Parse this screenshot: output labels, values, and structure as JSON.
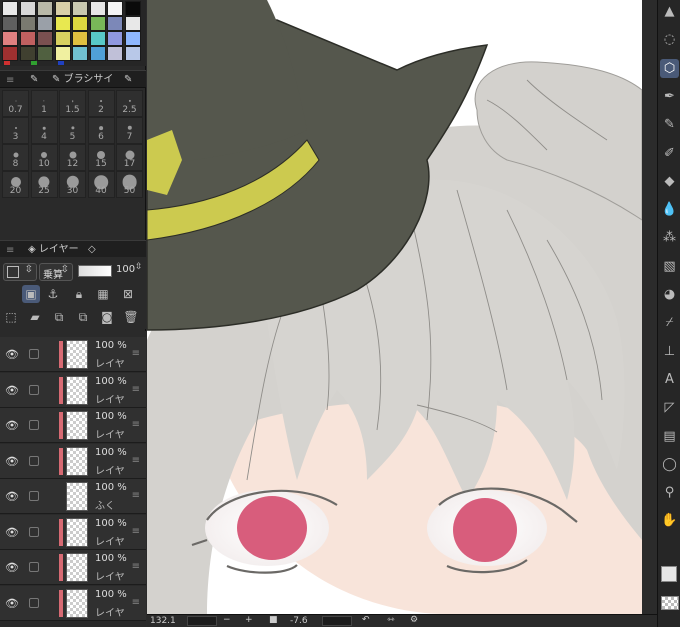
{
  "palette": {
    "rows": [
      [
        "#e8e8e8",
        "#d8d8d8",
        "#b8b8a8",
        "#d8cfa8",
        "#c8c8b0",
        "#e6e6e6",
        "#f4f4f4",
        "#0a0a0a"
      ],
      [
        "#5f5f5f",
        "#7a7a70",
        "#9aa0a8",
        "#e8e850",
        "#dcd840",
        "#78b858",
        "#7c88b8",
        "#e8e8e8"
      ],
      [
        "#e08080",
        "#c06060",
        "#7a5050",
        "#d8d060",
        "#e0c040",
        "#58c8c8",
        "#9098e0",
        "#8fb8ff"
      ],
      [
        "#a03030",
        "#404030",
        "#506040",
        "#f0f0a0",
        "#70c0d0",
        "#50a0d8",
        "#c0c0d8",
        "#b8c8e8"
      ]
    ],
    "indicators": [
      "#d03030",
      "#30a030",
      "#2040c0"
    ]
  },
  "brush_panel": {
    "tab_label": "ブラシサイ",
    "rows": [
      [
        "0.7",
        "1",
        "1.5",
        "2",
        "2.5"
      ],
      [
        "3",
        "4",
        "5",
        "6",
        "7"
      ],
      [
        "8",
        "10",
        "12",
        "15",
        "17"
      ],
      [
        "20",
        "25",
        "30",
        "40",
        "50"
      ]
    ]
  },
  "layer_panel": {
    "tab_label": "レイヤー",
    "blend_mode": "乗算",
    "opacity": "100"
  },
  "layers": [
    {
      "pct": "100 %",
      "name": "レイヤ",
      "type": "raster"
    },
    {
      "pct": "100 %",
      "name": "レイヤ",
      "type": "raster"
    },
    {
      "pct": "100 %",
      "name": "レイヤ",
      "type": "raster"
    },
    {
      "pct": "100 %",
      "name": "レイヤ",
      "type": "raster"
    },
    {
      "pct": "100 %",
      "name": "ふく",
      "type": "art"
    },
    {
      "pct": "100 %",
      "name": "レイヤ",
      "type": "raster"
    },
    {
      "pct": "100 %",
      "name": "レイヤ",
      "type": "raster"
    },
    {
      "pct": "100 %",
      "name": "レイヤ",
      "type": "raster"
    }
  ],
  "status": {
    "zoom": "132.1",
    "rotation": "-7.6"
  },
  "colors": {
    "hat": "#55574d",
    "hat_band": "#ccca4f",
    "hair": "#d3d1cd",
    "skin": "#f8e4da",
    "iris": "#d85d7c",
    "accent": "#4a5a78"
  },
  "right_tools": [
    "cursor-icon",
    "lasso-icon",
    "3d-cube-icon",
    "pen-icon",
    "pencil-icon",
    "brush-icon",
    "eraser-icon",
    "drop-icon",
    "airbrush-icon",
    "gradient-icon",
    "fill-icon",
    "eyedropper-icon",
    "stamp-icon",
    "text-icon",
    "ruler-icon",
    "frame-icon",
    "balloon-icon",
    "search-icon",
    "hand-icon"
  ]
}
